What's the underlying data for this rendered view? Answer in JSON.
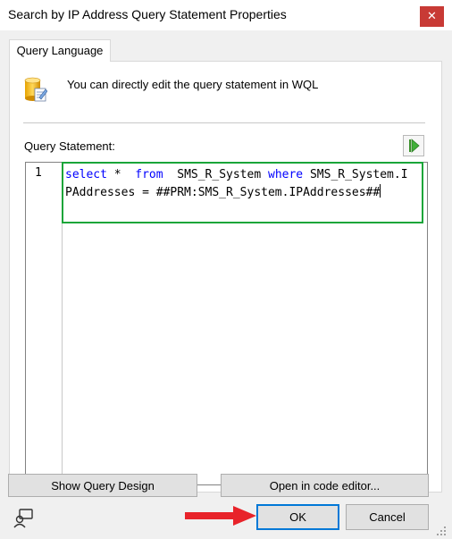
{
  "window": {
    "title": "Search by IP Address Query Statement Properties",
    "close_glyph": "✕"
  },
  "tabs": [
    {
      "label": "Query Language",
      "active": true
    }
  ],
  "info": {
    "icon": "database-edit-icon",
    "text": "You can directly edit the query statement in WQL"
  },
  "query": {
    "label": "Query Statement:",
    "run_icon": "run-play-icon",
    "line_number": "1",
    "tokens": [
      {
        "text": "select",
        "type": "keyword"
      },
      {
        "text": " *  ",
        "type": "plain"
      },
      {
        "text": "from",
        "type": "keyword"
      },
      {
        "text": "  SMS_R_System ",
        "type": "plain"
      },
      {
        "text": "where",
        "type": "keyword"
      },
      {
        "text": " SMS_R_System.IPAddresses = ##PRM:SMS_R_System.IPAddresses##",
        "type": "plain"
      }
    ]
  },
  "buttons": {
    "show_query_design": "Show Query Design",
    "open_in_code_editor": "Open in code editor...",
    "ok": "OK",
    "cancel": "Cancel"
  },
  "colors": {
    "keyword": "#0000ff",
    "highlight_border": "#1aa539",
    "arrow": "#e8232a",
    "close_button": "#c83a35",
    "primary_border": "#0078d7"
  },
  "icons": {
    "status": "feedback-person-icon",
    "pointer_arrow": "red-arrow-right-icon",
    "resize_grip": "resize-grip-icon"
  }
}
